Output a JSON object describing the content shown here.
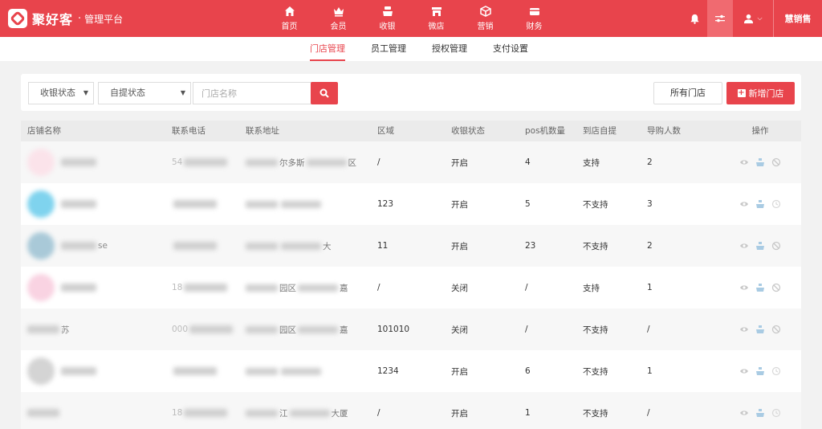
{
  "brand": {
    "name": "聚好客",
    "sep": "·",
    "platform": "管理平台"
  },
  "nav": [
    {
      "label": "首页",
      "icon": "home-icon"
    },
    {
      "label": "会员",
      "icon": "crown-icon"
    },
    {
      "label": "收银",
      "icon": "cashier-icon"
    },
    {
      "label": "微店",
      "icon": "shop-icon"
    },
    {
      "label": "营销",
      "icon": "box-icon"
    },
    {
      "label": "财务",
      "icon": "card-icon"
    }
  ],
  "account": {
    "label": "慧销售"
  },
  "subtabs": [
    "门店管理",
    "员工管理",
    "授权管理",
    "支付设置"
  ],
  "filters": {
    "cashier_status": "收银状态",
    "pickup_status": "自提状态",
    "store_name_placeholder": "门店名称",
    "all_stores": "所有门店",
    "add_store": "新增门店"
  },
  "table": {
    "headers": [
      "店铺名称",
      "联系电话",
      "联系地址",
      "区域",
      "收银状态",
      "pos机数量",
      "到店自提",
      "导购人数",
      "操作"
    ],
    "rows": [
      {
        "name_visible": "",
        "phone_visible": "54",
        "addr_visible": "尔多斯",
        "addr_visible2": "区",
        "region": "/",
        "cashier": "开启",
        "pos": "4",
        "pickup": "支持",
        "guides": "2"
      },
      {
        "name_visible": "",
        "phone_visible": "",
        "addr_visible": "",
        "addr_visible2": "",
        "region": "123",
        "cashier": "开启",
        "pos": "5",
        "pickup": "不支持",
        "guides": "3"
      },
      {
        "name_visible": "se",
        "phone_visible": "",
        "addr_visible": "",
        "addr_visible2": "大",
        "region": "11",
        "cashier": "开启",
        "pos": "23",
        "pickup": "不支持",
        "guides": "2"
      },
      {
        "name_visible": "",
        "phone_visible": "18",
        "addr_visible": "园区",
        "addr_visible2": "嘉",
        "region": "/",
        "cashier": "关闭",
        "pos": "/",
        "pickup": "支持",
        "guides": "1"
      },
      {
        "name_visible": "苏",
        "phone_visible": "000",
        "addr_visible": "园区",
        "addr_visible2": "嘉",
        "region": "101010",
        "cashier": "关闭",
        "pos": "/",
        "pickup": "不支持",
        "guides": "/"
      },
      {
        "name_visible": "",
        "phone_visible": "",
        "addr_visible": "",
        "addr_visible2": "",
        "region": "1234",
        "cashier": "开启",
        "pos": "6",
        "pickup": "不支持",
        "guides": "1"
      },
      {
        "name_visible": "",
        "phone_visible": "18",
        "addr_visible": "江",
        "addr_visible2": "大厦",
        "region": "/",
        "cashier": "开启",
        "pos": "1",
        "pickup": "不支持",
        "guides": "/"
      }
    ]
  },
  "colors": {
    "accent": "#e8444c",
    "header_bg": "#ebebeb"
  }
}
